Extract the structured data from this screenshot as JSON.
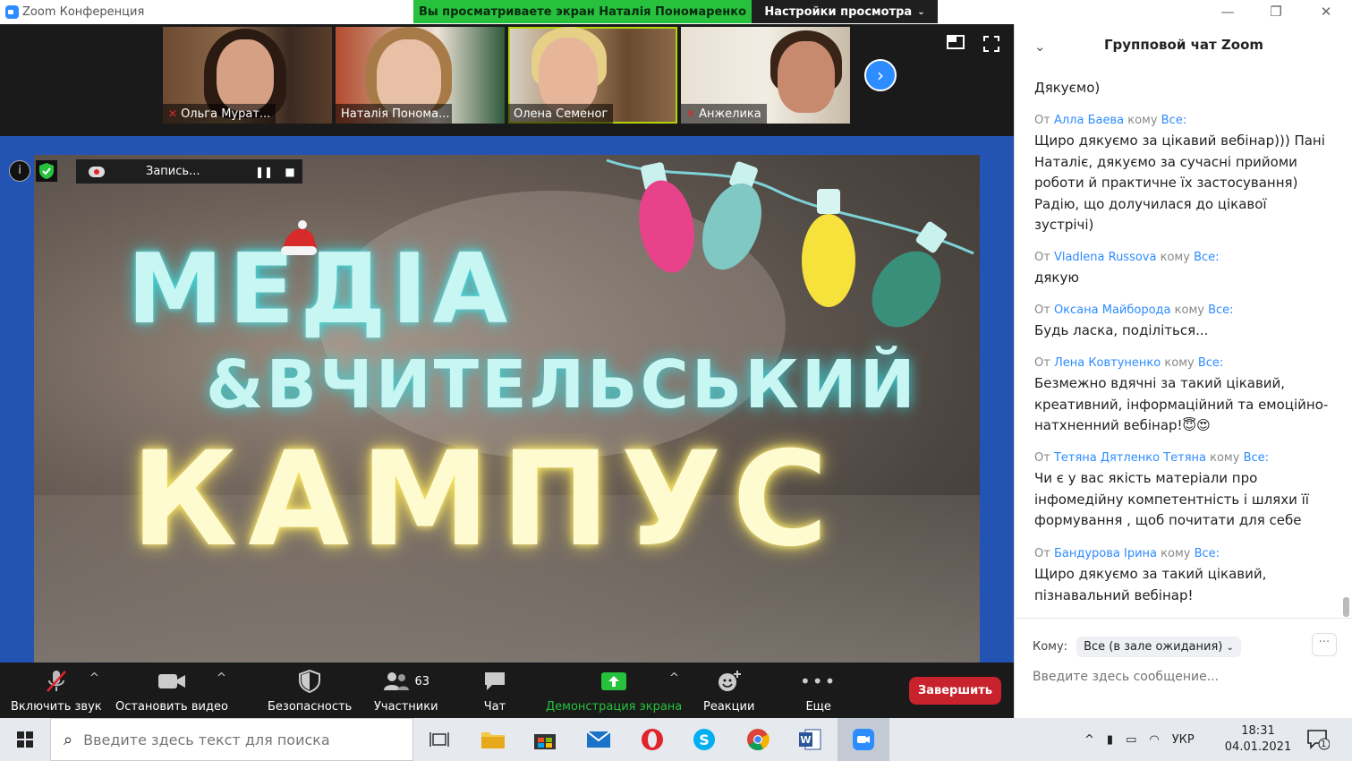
{
  "window": {
    "title": "Zoom Конференция",
    "share_banner": "Вы просматриваете экран Наталія Пономаренко",
    "view_options": "Настройки просмотра",
    "minimize": "—",
    "restore": "❐",
    "close": "✕"
  },
  "thumbnails": [
    {
      "name": "Ольга Мурат...",
      "muted": true
    },
    {
      "name": "Наталія Понома...",
      "muted": false
    },
    {
      "name": "Олена Семеног",
      "muted": false
    },
    {
      "name": "Анжелика",
      "muted": true
    }
  ],
  "next_icon": "›",
  "share_tools": {
    "info": "i",
    "recording": "Запись...",
    "pause": "❚❚",
    "stop": "■"
  },
  "slide": {
    "line1": "МЕДІА",
    "line2": "&ВЧИТЕЛЬСЬКИЙ",
    "line3": "КАМПУС"
  },
  "toolbar": {
    "audio": "Включить звук",
    "video": "Остановить видео",
    "security": "Безопасность",
    "participants": "Участники",
    "participants_count": "63",
    "chat": "Чат",
    "share": "Демонстрация экрана",
    "reactions": "Реакции",
    "more": "Еще",
    "end": "Завершить"
  },
  "chat": {
    "title": "Групповой чат Zoom",
    "collapse": "⌄",
    "from_word": "От",
    "to_word": "кому",
    "all_word": "Все:",
    "messages": [
      {
        "from": "",
        "text": "Дякуємо)"
      },
      {
        "from": "Алла Баева",
        "text": "Щиро дякуємо за цікавий вебінар))) Пані Наталіє, дякуємо за сучасні прийоми роботи  й практичне їх застосування) Радію, що долучилася до цікавої зустрічі)"
      },
      {
        "from": "Vladlena Russova",
        "text": "дякую"
      },
      {
        "from": "Оксана Майборода",
        "text": "Будь ласка, поділіться..."
      },
      {
        "from": "Лена Ковтуненко",
        "text": "Безмежно вдячні за такий цікавий, креативний, інформаційний та емоційно-натхненний вебінар!😇😍"
      },
      {
        "from": "Тетяна Дятленко Тетяна",
        "text": "Чи є у вас якість матеріали про інфомедійну компетентність і шляхи її формування , щоб почитати для себе"
      },
      {
        "from": "Бандурова Ірина",
        "text": "Щиро дякуємо  за такий цікавий, пізнавальний вебінар!"
      }
    ],
    "to_label": "Кому:",
    "to_value": "Все (в зале ожидания)",
    "more": "···",
    "placeholder": "Введите здесь сообщение..."
  },
  "taskbar": {
    "search_placeholder": "Введите здесь текст для поиска",
    "lang": "УКР",
    "time": "18:31",
    "date": "04.01.2021",
    "notif_count": "1"
  },
  "colors": {
    "zoom_blue": "#2d8cff",
    "banner_green": "#27c13e",
    "end_red": "#c8232c",
    "share_border": "#2454b3"
  }
}
